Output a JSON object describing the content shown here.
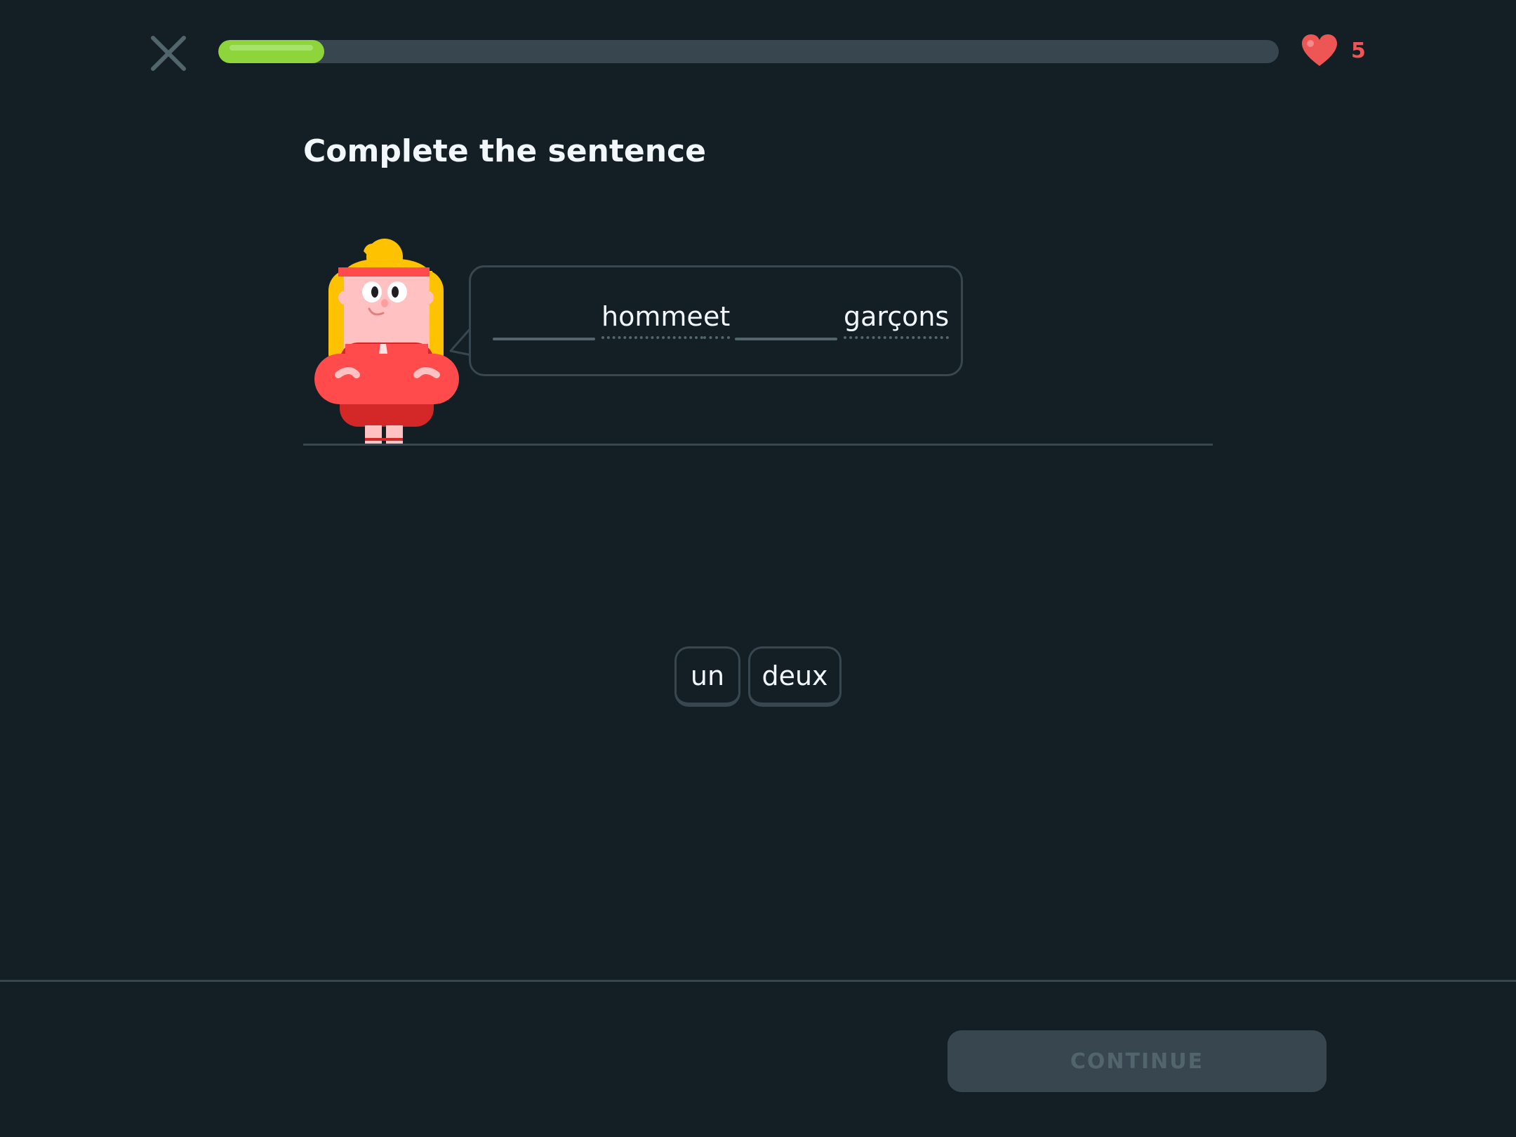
{
  "header": {
    "close_icon": "close-x-icon",
    "progress": 0.1,
    "hearts_icon": "heart-icon",
    "hearts": "5"
  },
  "exercise": {
    "title": "Complete the sentence",
    "sentence": {
      "word_1": "homme",
      "word_2": "et",
      "word_3": "garçons"
    },
    "choices": [
      "un",
      "deux"
    ]
  },
  "footer": {
    "continue_label": "CONTINUE"
  },
  "colors": {
    "background": "#131f24",
    "progress_fill": "#8ed53c",
    "heart": "#ee5555",
    "border": "#37464f"
  }
}
